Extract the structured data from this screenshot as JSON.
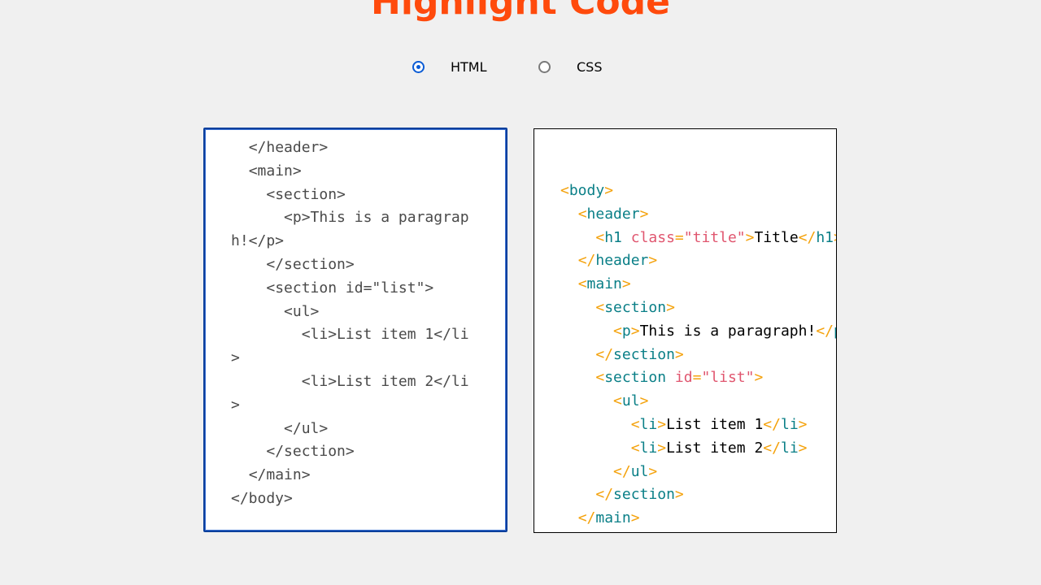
{
  "page": {
    "title": "Highlight Code"
  },
  "language_selector": {
    "options": [
      {
        "label": "HTML",
        "checked": true
      },
      {
        "label": "CSS",
        "checked": false
      }
    ]
  },
  "editor": {
    "code": "  </header>\n  <main>\n    <section>\n      <p>This is a paragraph!</p>\n    </section>\n    <section id=\"list\">\n      <ul>\n        <li>List item 1</li>\n        <li>List item 2</li>\n      </ul>\n    </section>\n  </main>\n</body>"
  },
  "preview": {
    "lines": [
      [
        {
          "t": "<",
          "k": "punct"
        },
        {
          "t": "body",
          "k": "tag"
        },
        {
          "t": ">",
          "k": "punct"
        }
      ],
      [
        {
          "t": "  ",
          "k": "text"
        },
        {
          "t": "<",
          "k": "punct"
        },
        {
          "t": "header",
          "k": "tag"
        },
        {
          "t": ">",
          "k": "punct"
        }
      ],
      [
        {
          "t": "    ",
          "k": "text"
        },
        {
          "t": "<",
          "k": "punct"
        },
        {
          "t": "h1",
          "k": "tag"
        },
        {
          "t": " ",
          "k": "text"
        },
        {
          "t": "class",
          "k": "attr"
        },
        {
          "t": "=",
          "k": "punct"
        },
        {
          "t": "\"title\"",
          "k": "val"
        },
        {
          "t": ">",
          "k": "punct"
        },
        {
          "t": "Title",
          "k": "text"
        },
        {
          "t": "</",
          "k": "punct"
        },
        {
          "t": "h1",
          "k": "tag"
        },
        {
          "t": ">",
          "k": "punct"
        }
      ],
      [
        {
          "t": "  ",
          "k": "text"
        },
        {
          "t": "</",
          "k": "punct"
        },
        {
          "t": "header",
          "k": "tag"
        },
        {
          "t": ">",
          "k": "punct"
        }
      ],
      [
        {
          "t": "  ",
          "k": "text"
        },
        {
          "t": "<",
          "k": "punct"
        },
        {
          "t": "main",
          "k": "tag"
        },
        {
          "t": ">",
          "k": "punct"
        }
      ],
      [
        {
          "t": "    ",
          "k": "text"
        },
        {
          "t": "<",
          "k": "punct"
        },
        {
          "t": "section",
          "k": "tag"
        },
        {
          "t": ">",
          "k": "punct"
        }
      ],
      [
        {
          "t": "      ",
          "k": "text"
        },
        {
          "t": "<",
          "k": "punct"
        },
        {
          "t": "p",
          "k": "tag"
        },
        {
          "t": ">",
          "k": "punct"
        },
        {
          "t": "This is a paragraph!",
          "k": "text"
        },
        {
          "t": "</",
          "k": "punct"
        },
        {
          "t": "p",
          "k": "tag"
        },
        {
          "t": ">",
          "k": "punct"
        }
      ],
      [
        {
          "t": "    ",
          "k": "text"
        },
        {
          "t": "</",
          "k": "punct"
        },
        {
          "t": "section",
          "k": "tag"
        },
        {
          "t": ">",
          "k": "punct"
        }
      ],
      [
        {
          "t": "    ",
          "k": "text"
        },
        {
          "t": "<",
          "k": "punct"
        },
        {
          "t": "section",
          "k": "tag"
        },
        {
          "t": " ",
          "k": "text"
        },
        {
          "t": "id",
          "k": "attr"
        },
        {
          "t": "=",
          "k": "punct"
        },
        {
          "t": "\"list\"",
          "k": "val"
        },
        {
          "t": ">",
          "k": "punct"
        }
      ],
      [
        {
          "t": "      ",
          "k": "text"
        },
        {
          "t": "<",
          "k": "punct"
        },
        {
          "t": "ul",
          "k": "tag"
        },
        {
          "t": ">",
          "k": "punct"
        }
      ],
      [
        {
          "t": "        ",
          "k": "text"
        },
        {
          "t": "<",
          "k": "punct"
        },
        {
          "t": "li",
          "k": "tag"
        },
        {
          "t": ">",
          "k": "punct"
        },
        {
          "t": "List item 1",
          "k": "text"
        },
        {
          "t": "</",
          "k": "punct"
        },
        {
          "t": "li",
          "k": "tag"
        },
        {
          "t": ">",
          "k": "punct"
        }
      ],
      [
        {
          "t": "        ",
          "k": "text"
        },
        {
          "t": "<",
          "k": "punct"
        },
        {
          "t": "li",
          "k": "tag"
        },
        {
          "t": ">",
          "k": "punct"
        },
        {
          "t": "List item 2",
          "k": "text"
        },
        {
          "t": "</",
          "k": "punct"
        },
        {
          "t": "li",
          "k": "tag"
        },
        {
          "t": ">",
          "k": "punct"
        }
      ],
      [
        {
          "t": "      ",
          "k": "text"
        },
        {
          "t": "</",
          "k": "punct"
        },
        {
          "t": "ul",
          "k": "tag"
        },
        {
          "t": ">",
          "k": "punct"
        }
      ],
      [
        {
          "t": "    ",
          "k": "text"
        },
        {
          "t": "</",
          "k": "punct"
        },
        {
          "t": "section",
          "k": "tag"
        },
        {
          "t": ">",
          "k": "punct"
        }
      ],
      [
        {
          "t": "  ",
          "k": "text"
        },
        {
          "t": "</",
          "k": "punct"
        },
        {
          "t": "main",
          "k": "tag"
        },
        {
          "t": ">",
          "k": "punct"
        }
      ]
    ]
  },
  "colors": {
    "title": "#ff4a0c",
    "radio_checked": "#0b5cd5",
    "editor_border": "#0a3f9c",
    "token_punctuation": "#f4a20c",
    "token_tag": "#0a7f87",
    "token_attribute": "#e0566f",
    "token_text": "#000000"
  }
}
